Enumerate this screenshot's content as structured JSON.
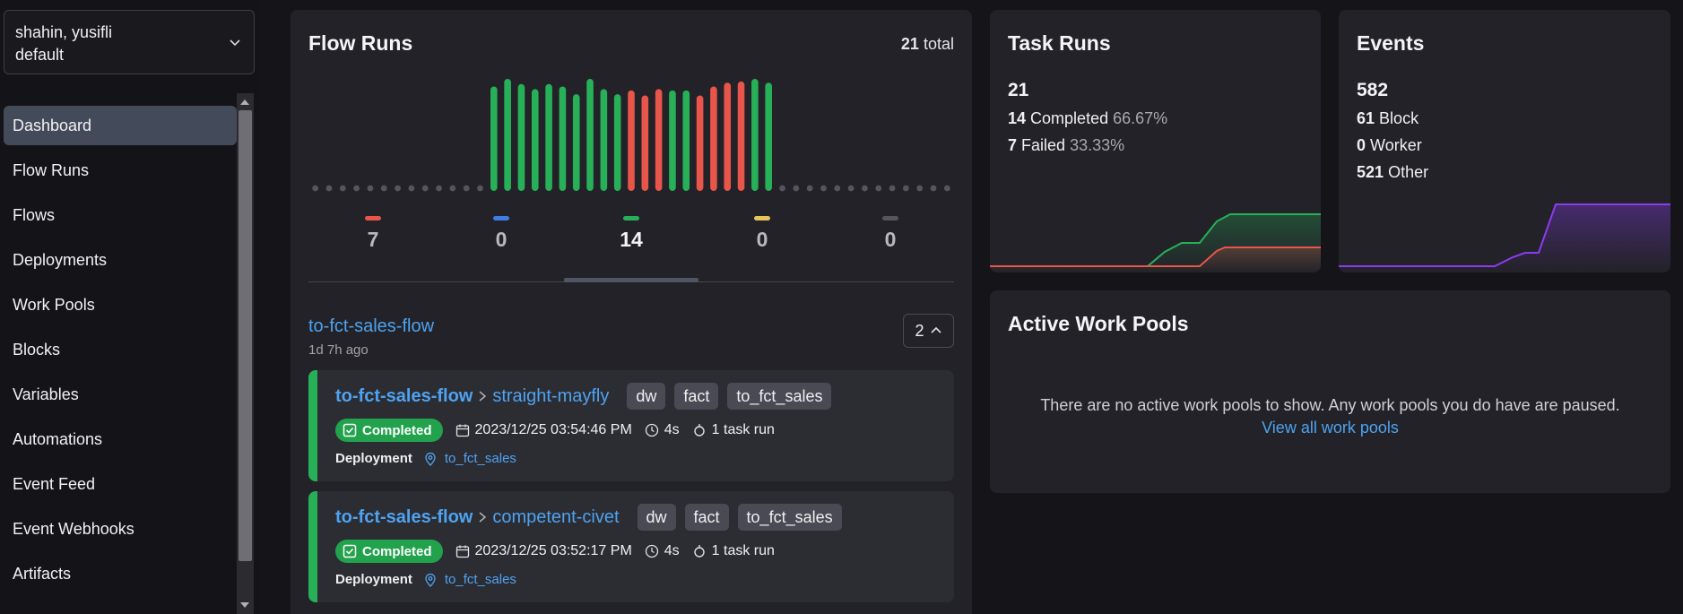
{
  "workspace": {
    "account": "shahin, yusifli",
    "name": "default"
  },
  "nav": {
    "items": [
      {
        "label": "Dashboard",
        "active": true
      },
      {
        "label": "Flow Runs"
      },
      {
        "label": "Flows"
      },
      {
        "label": "Deployments"
      },
      {
        "label": "Work Pools"
      },
      {
        "label": "Blocks"
      },
      {
        "label": "Variables"
      },
      {
        "label": "Automations"
      },
      {
        "label": "Event Feed"
      },
      {
        "label": "Event Webhooks"
      },
      {
        "label": "Artifacts"
      }
    ]
  },
  "flow_runs": {
    "title": "Flow Runs",
    "total_count": "21",
    "total_label": "total",
    "histogram": {
      "empty_before": 13,
      "bars": [
        "completed",
        "completed",
        "completed",
        "completed",
        "completed",
        "completed",
        "completed",
        "completed",
        "completed",
        "completed",
        "failed",
        "failed",
        "failed",
        "completed",
        "completed",
        "failed",
        "failed",
        "failed",
        "failed",
        "completed",
        "completed"
      ],
      "heights": [
        0.82,
        0.88,
        0.84,
        0.8,
        0.84,
        0.82,
        0.76,
        0.88,
        0.8,
        0.76,
        0.79,
        0.75,
        0.8,
        0.79,
        0.79,
        0.75,
        0.82,
        0.85,
        0.86,
        0.88,
        0.85
      ],
      "empty_after": 13
    },
    "state_counts": [
      {
        "state": "failed",
        "value": "7",
        "color": "#e8554a"
      },
      {
        "state": "running",
        "value": "0",
        "color": "#3f7ce8"
      },
      {
        "state": "completed",
        "value": "14",
        "color": "#27b058",
        "active": true
      },
      {
        "state": "pending",
        "value": "0",
        "color": "#e8c25a"
      },
      {
        "state": "cancelled",
        "value": "0",
        "color": "#55555c"
      }
    ],
    "group": {
      "flow_name": "to-fct-sales-flow",
      "ago": "1d 7h ago",
      "count": "2"
    },
    "runs": [
      {
        "flow_name": "to-fct-sales-flow",
        "run_name": "straight-mayfly",
        "tags": [
          "dw",
          "fact",
          "to_fct_sales"
        ],
        "state": "Completed",
        "timestamp": "2023/12/25 03:54:46 PM",
        "duration": "4s",
        "task_runs": "1 task run",
        "deployment_label": "Deployment",
        "deployment": "to_fct_sales"
      },
      {
        "flow_name": "to-fct-sales-flow",
        "run_name": "competent-civet",
        "tags": [
          "dw",
          "fact",
          "to_fct_sales"
        ],
        "state": "Completed",
        "timestamp": "2023/12/25 03:52:17 PM",
        "duration": "4s",
        "task_runs": "1 task run",
        "deployment_label": "Deployment",
        "deployment": "to_fct_sales"
      }
    ]
  },
  "task_runs": {
    "title": "Task Runs",
    "total": "21",
    "completed_count": "14",
    "completed_label": "Completed",
    "completed_pct": "66.67%",
    "failed_count": "7",
    "failed_label": "Failed",
    "failed_pct": "33.33%",
    "colors": {
      "completed": "#27b058",
      "failed": "#e8554a"
    }
  },
  "events": {
    "title": "Events",
    "total": "582",
    "block_count": "61",
    "block_label": "Block",
    "worker_count": "0",
    "worker_label": "Worker",
    "other_count": "521",
    "other_label": "Other",
    "color": "#8b3cf0"
  },
  "work_pools": {
    "title": "Active Work Pools",
    "empty_message": "There are no active work pools to show. Any work pools you do have are paused.",
    "link": "View all work pools"
  }
}
